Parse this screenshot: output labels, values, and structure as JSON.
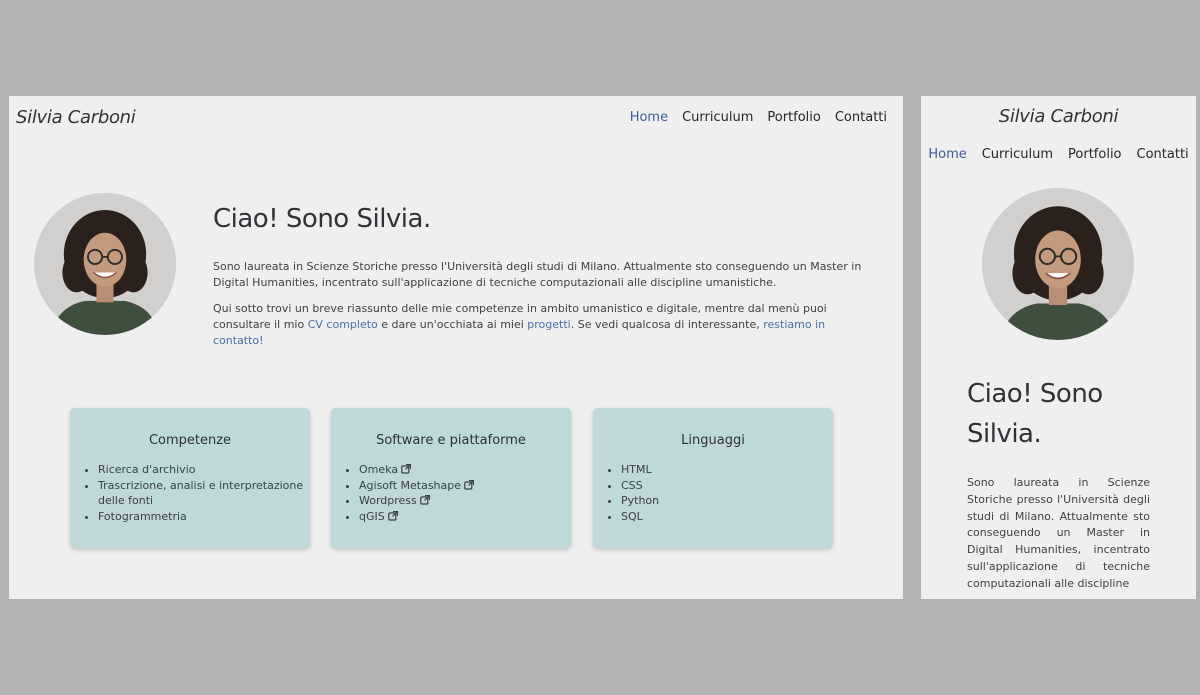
{
  "site": {
    "brand": "Silvia Carboni",
    "nav": [
      "Home",
      "Curriculum",
      "Portfolio",
      "Contatti"
    ],
    "active_nav": "Home"
  },
  "hero": {
    "title": "Ciao! Sono Silvia.",
    "mobile_title_line1": "Ciao! Sono",
    "mobile_title_line2": "Silvia.",
    "intro": "Sono laureata in Scienze Storiche presso l'Università degli studi di Milano. Attualmente sto conseguendo un Master in Digital Humanities, incentrato sull'applicazione di tecniche computazionali alle discipline umanistiche.",
    "p2_before": "Qui sotto trovi un breve riassunto delle mie competenze in ambito umanistico e digitale, mentre dal menù puoi consultare il mio ",
    "cv_link": "CV completo",
    "p2_middle": " e dare un'occhiata ai miei ",
    "projects_link": "progetti",
    "p2_after": ". Se vedi qualcosa di interessante, ",
    "contact_link": "restiamo in contatto!"
  },
  "cards": {
    "competenze": {
      "title": "Competenze",
      "items": [
        "Ricerca d'archivio",
        "Trascrizione, analisi e interpretazione delle fonti",
        "Fotogrammetria"
      ]
    },
    "software": {
      "title": "Software e piattaforme",
      "items": [
        "Omeka",
        "Agisoft Metashape",
        "Wordpress",
        "qGIS"
      ]
    },
    "linguaggi": {
      "title": "Linguaggi",
      "items": [
        "HTML",
        "CSS",
        "Python",
        "SQL"
      ]
    }
  },
  "mobile": {
    "intro_visible": "Sono laureata in Scienze Storiche presso l'Università degli studi di Milano. Attualmente sto conseguendo un Master in Digital Humanities, incentrato sull'applicazione di tecniche computazionali alle discipline"
  },
  "colors": {
    "page_bg": "#b3b3b4",
    "panel_bg": "#efefef",
    "card_bg": "#bfd9d9",
    "accent": "#3d5f95"
  },
  "icons": {
    "external_link": "external-link-icon"
  }
}
